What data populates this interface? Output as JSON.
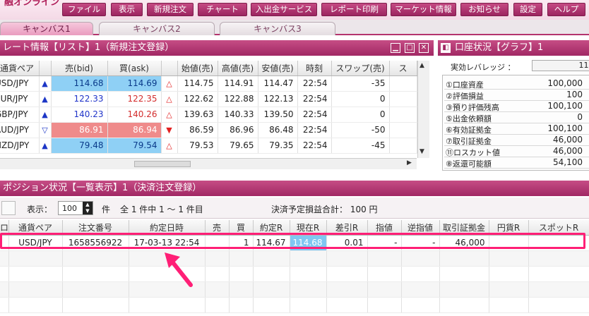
{
  "app": {
    "logo": "融オンライン"
  },
  "menu": [
    "ファイル",
    "表示",
    "新規注文",
    "チャート",
    "入出金サービス",
    "レポート印刷",
    "マーケット情報",
    "お知らせ",
    "設定",
    "ヘルプ"
  ],
  "tabs": [
    "キャンバス1",
    "キャンバス2",
    "キャンバス3"
  ],
  "rate_window": {
    "title": "レート情報【リスト】1（新規注文登録）",
    "columns": [
      "通貨ペア",
      "",
      "売(bid)",
      "買(ask)",
      "",
      "始値(売)",
      "高値(売)",
      "安値(売)",
      "時刻",
      "スワップ(売)",
      "ス"
    ],
    "rows": [
      {
        "pair": "USD/JPY",
        "dir": "▲",
        "bid": "114.68",
        "ask": "114.69",
        "mark": "△",
        "open": "114.75",
        "high": "114.91",
        "low": "114.47",
        "time": "22:54",
        "swap": "-35"
      },
      {
        "pair": "EUR/JPY",
        "dir": "▲",
        "bid": "122.33",
        "ask": "122.35",
        "mark": "△",
        "open": "122.62",
        "high": "122.88",
        "low": "122.13",
        "time": "22:54",
        "swap": "0"
      },
      {
        "pair": "GBP/JPY",
        "dir": "▲",
        "bid": "140.23",
        "ask": "140.26",
        "mark": "△",
        "open": "139.63",
        "high": "140.33",
        "low": "139.50",
        "time": "22:54",
        "swap": "0"
      },
      {
        "pair": "AUD/JPY",
        "dir": "▽",
        "bid": "86.91",
        "ask": "86.94",
        "mark": "▼",
        "open": "86.59",
        "high": "86.96",
        "low": "86.48",
        "time": "22:54",
        "swap": "-50"
      },
      {
        "pair": "NZD/JPY",
        "dir": "▲",
        "bid": "79.48",
        "ask": "79.54",
        "mark": "△",
        "open": "79.53",
        "high": "79.65",
        "low": "79.35",
        "time": "22:54",
        "swap": "-45"
      }
    ]
  },
  "account_window": {
    "title": "口座状況【グラフ】1",
    "leverage_label": "実効レバレッジ ：",
    "leverage_value": "11.",
    "rows": [
      {
        "k": "①口座資産",
        "v": "100,000"
      },
      {
        "k": "②評価損益",
        "v": "100"
      },
      {
        "k": "③預り評価残高",
        "v": "100,100"
      },
      {
        "k": "⑤出金依頼額",
        "v": "0"
      },
      {
        "k": "⑥有効証拠金",
        "v": "100,100"
      },
      {
        "k": "⑦取引証拠金",
        "v": "46,000"
      },
      {
        "k": "⑪ロスカット値",
        "v": "46,000"
      },
      {
        "k": "⑧返還可能額",
        "v": "54,100"
      }
    ]
  },
  "position_window": {
    "title": "ポジション状況【一覧表示】1（決済注文登録）",
    "display_label": "表示：",
    "display_count": "100",
    "unit": "件",
    "count_text": "全 1 件中 1 ～ 1 件目",
    "pnl_text": "決済予定損益合計： 100 円",
    "columns": [
      "ロ",
      "通貨ペア",
      "注文番号",
      "約定日時",
      "売",
      "買",
      "約定R",
      "現在R",
      "差引R",
      "指値",
      "逆指値",
      "取引証拠金",
      "円貨R",
      "スポットR"
    ],
    "row": {
      "pair": "USD/JPY",
      "order": "1658556922",
      "datetime": "17-03-13 22:54",
      "sell": "",
      "buy": "1",
      "rate": "114.67",
      "current": "114.68",
      "diff": "0.01",
      "limit": "-",
      "stop": "-",
      "margin": "46,000",
      "yen": "",
      "spot": ""
    }
  }
}
